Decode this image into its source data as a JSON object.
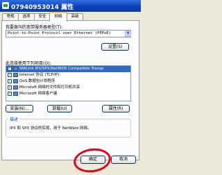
{
  "window": {
    "title": "07940953014 属性"
  },
  "tabs": [
    "常规",
    "选项",
    "安全",
    "网络",
    "高级"
  ],
  "network": {
    "dial_type_label": "我要拨叫的宽带服务器类型(T):",
    "dial_type_value": "Point-to-Point Protocol over Ethernet (PPPoE)",
    "settings_button": "设置(S)",
    "items_label": "此连接使用下列项目(O):",
    "items": [
      {
        "label": "NWLink IPX/SPX/NetBIOS Compatible Transp",
        "checked": true,
        "selected": true
      },
      {
        "label": "Internet 协议 (TCP/IP)",
        "checked": true,
        "selected": false
      },
      {
        "label": "QoS 数据包计划程序",
        "checked": true,
        "selected": false
      },
      {
        "label": "Microsoft 网络的文件和打印机共享",
        "checked": true,
        "selected": false
      },
      {
        "label": "Microsoft 网络客户端",
        "checked": true,
        "selected": false
      }
    ],
    "install_button": "安装(N)...",
    "uninstall_button": "卸载(U)",
    "properties_button": "属性(R)",
    "description_title": "描述",
    "description_text": "IPX 和 SPX 协议的实现，用于 NetWare 网络。"
  },
  "footer": {
    "ok_button": "确定",
    "cancel_button": "取消"
  },
  "colors": {
    "titlebar": "#0a3fb8",
    "selection": "#316ac5",
    "annotation_ring": "#e3001b"
  }
}
